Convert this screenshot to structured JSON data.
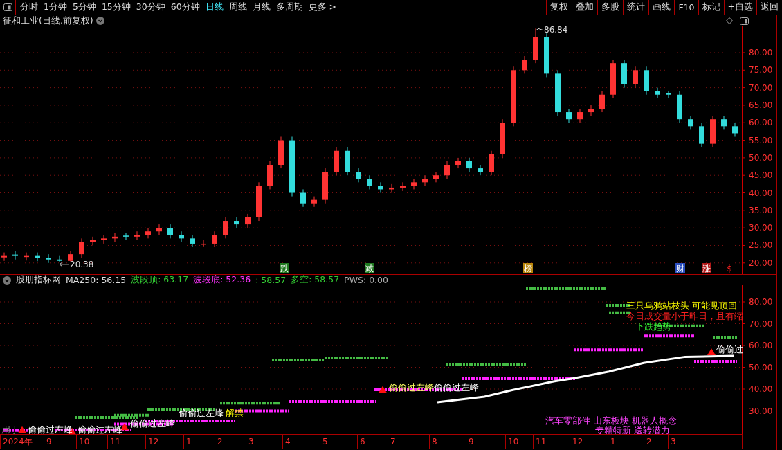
{
  "toolbar": {
    "periods": [
      {
        "label": "分时",
        "selected": false
      },
      {
        "label": "1分钟",
        "selected": false
      },
      {
        "label": "5分钟",
        "selected": false
      },
      {
        "label": "15分钟",
        "selected": false
      },
      {
        "label": "30分钟",
        "selected": false
      },
      {
        "label": "60分钟",
        "selected": false
      },
      {
        "label": "日线",
        "selected": true
      },
      {
        "label": "周线",
        "selected": false
      },
      {
        "label": "月线",
        "selected": false
      },
      {
        "label": "多周期",
        "selected": false
      },
      {
        "label": "更多 >",
        "selected": false
      }
    ],
    "buttons": [
      "复权",
      "叠加",
      "多股",
      "统计",
      "画线",
      "F10",
      "标记",
      "+自选",
      "返回"
    ]
  },
  "price_panel": {
    "title": "征和工业(日线.前复权)",
    "chart_data": {
      "type": "candlestick",
      "categories": [
        null,
        null,
        null,
        null,
        null,
        null,
        null,
        null,
        null,
        null,
        null,
        null,
        null,
        null,
        null,
        null,
        null,
        null,
        null,
        null,
        null,
        null,
        null,
        null,
        null,
        null,
        null,
        null,
        null,
        null,
        null,
        null,
        null,
        null,
        null,
        null,
        null,
        null,
        null,
        null,
        null,
        null,
        null,
        null,
        null,
        null,
        null,
        null,
        null,
        null,
        null,
        null,
        null,
        null,
        null,
        null,
        null,
        null,
        null,
        null,
        null,
        null,
        null,
        null,
        null,
        null,
        null
      ],
      "grid": true,
      "ylim": [
        16.8,
        87.5
      ],
      "yticks": [
        {
          "value": 20,
          "label": "20.00"
        },
        {
          "value": 25,
          "label": "25.00"
        },
        {
          "value": 30,
          "label": "30.00"
        },
        {
          "value": 35,
          "label": "35.00"
        },
        {
          "value": 40,
          "label": "40.00"
        },
        {
          "value": 45,
          "label": "45.00"
        },
        {
          "value": 50,
          "label": "50.00"
        },
        {
          "value": 55,
          "label": "55.00"
        },
        {
          "value": 60,
          "label": "60.00"
        },
        {
          "value": 65,
          "label": "65.00"
        },
        {
          "value": 70,
          "label": "70.00"
        },
        {
          "value": 75,
          "label": "75.00"
        },
        {
          "value": 80,
          "label": "80.00"
        }
      ],
      "ohlc": [
        [
          21.6,
          23,
          20.6,
          22
        ],
        [
          22.4,
          23.4,
          21,
          22
        ],
        [
          21.7,
          23,
          20.7,
          22
        ],
        [
          22,
          23,
          20.5,
          21.5
        ],
        [
          21.5,
          22.5,
          20,
          21
        ],
        [
          21,
          22,
          20.38,
          20.6
        ],
        [
          20.6,
          23.5,
          20.4,
          22.5
        ],
        [
          22.5,
          27,
          21.5,
          26
        ],
        [
          26,
          27.5,
          25,
          26.5
        ],
        [
          26.5,
          28,
          25.5,
          27
        ],
        [
          27,
          28.5,
          26,
          27.5
        ],
        [
          27.8,
          28.5,
          26.5,
          27.5
        ],
        [
          27.5,
          29,
          26.5,
          28
        ],
        [
          28,
          30,
          27,
          29
        ],
        [
          29,
          31,
          28,
          30
        ],
        [
          30,
          31,
          27,
          28
        ],
        [
          28,
          29,
          26,
          27
        ],
        [
          27,
          28,
          24.5,
          25.5
        ],
        [
          25.2,
          26.5,
          24.5,
          25.5
        ],
        [
          25.5,
          29,
          24.5,
          28
        ],
        [
          28,
          33,
          27,
          32
        ],
        [
          32,
          33,
          30,
          31
        ],
        [
          31,
          34,
          30,
          33
        ],
        [
          33,
          43,
          32,
          42
        ],
        [
          42,
          49,
          41,
          48
        ],
        [
          48,
          56,
          47,
          55
        ],
        [
          55,
          56,
          39,
          40
        ],
        [
          40,
          41,
          36,
          37
        ],
        [
          37,
          39,
          36,
          38
        ],
        [
          38,
          47,
          37,
          46
        ],
        [
          46,
          53,
          45,
          52
        ],
        [
          52,
          53,
          45,
          46
        ],
        [
          46,
          47,
          43,
          44
        ],
        [
          44,
          45,
          41,
          42
        ],
        [
          42,
          43,
          40,
          41
        ],
        [
          41,
          42.5,
          40,
          41.5
        ],
        [
          41.5,
          43,
          40.5,
          42
        ],
        [
          42,
          44,
          41,
          43
        ],
        [
          43,
          45,
          42,
          44
        ],
        [
          44,
          46,
          43,
          45
        ],
        [
          45,
          49,
          44,
          48
        ],
        [
          48,
          50,
          47,
          49
        ],
        [
          49,
          50,
          46,
          47
        ],
        [
          47,
          48,
          45,
          46
        ],
        [
          46,
          52,
          45,
          51
        ],
        [
          51,
          61,
          50,
          60
        ],
        [
          60,
          76,
          59,
          75
        ],
        [
          75,
          79,
          74,
          78
        ],
        [
          78,
          86.84,
          77,
          84.5
        ],
        [
          84.5,
          85.5,
          73,
          74
        ],
        [
          74,
          75,
          62,
          63
        ],
        [
          63,
          64,
          60,
          61
        ],
        [
          61,
          64,
          60,
          63
        ],
        [
          63,
          65,
          62,
          64
        ],
        [
          64,
          69,
          63,
          68
        ],
        [
          68,
          78,
          67,
          77
        ],
        [
          77,
          78,
          70,
          71
        ],
        [
          71,
          76,
          70,
          75
        ],
        [
          75,
          76,
          68,
          69
        ],
        [
          69,
          70,
          67,
          68
        ],
        [
          68.4,
          69,
          67,
          68
        ],
        [
          68,
          69,
          60,
          61
        ],
        [
          61,
          62,
          58,
          59
        ],
        [
          59,
          60,
          53,
          54
        ],
        [
          54,
          62,
          53,
          61
        ],
        [
          61,
          62,
          58,
          59
        ],
        [
          59,
          60,
          56,
          57
        ]
      ]
    },
    "price_labels": [
      "86.84",
      "20.38"
    ],
    "markers": [
      {
        "text": "跌",
        "kind": "badge",
        "color": "#1f7a1f"
      },
      {
        "text": "减",
        "kind": "badge",
        "color": "#1f7a1f"
      },
      {
        "text": "榜",
        "kind": "badge",
        "color": "#b8860b"
      },
      {
        "text": "财",
        "kind": "badge",
        "color": "#2a4fbf"
      },
      {
        "text": "涨",
        "kind": "badge",
        "color": "#b01818"
      },
      {
        "text": "$",
        "kind": "text"
      }
    ]
  },
  "indicator_panel": {
    "readouts": [
      {
        "text": "股朋指标网",
        "color": "#dddddd"
      },
      {
        "text": "MA250: 56.15",
        "color": "#dddddd"
      },
      {
        "text": "波段顶: 63.17",
        "color": "#33cc33"
      },
      {
        "text": "波段底: 52.36",
        "color": "#ff33ff"
      },
      {
        "text": ": 58.57",
        "color": "#33cc33"
      },
      {
        "text": "多空: 58.57",
        "color": "#33cc33"
      },
      {
        "text": "PWS: 0.00",
        "color": "#aaaaaa"
      }
    ],
    "axis_labels": [
      "80.00",
      "70.00",
      "60.00",
      "50.00",
      "40.00",
      "30.00"
    ],
    "notes": [
      {
        "text": "三只乌鸦站枝头 可能见顶回",
        "color": "#ffff00"
      },
      {
        "text": "今日成交量小于昨日，且有缩",
        "color": "#ff2020"
      },
      {
        "text": "下跌趋势",
        "color": "#33ee33"
      },
      {
        "text": "偷偷过",
        "color": "#ffffff"
      },
      {
        "text": "偷偷过左峰",
        "color": "#ffff66"
      },
      {
        "text": "偷偷过左峰",
        "color": "#ffffff"
      },
      {
        "text": "偷偷过左峰",
        "color": "#ffffff"
      },
      {
        "text": "解禁",
        "color": "#ffff00"
      },
      {
        "text": "偷偷过左峰",
        "color": "#ffffff"
      },
      {
        "text": "汽车零部件 山东板块 机器人概念",
        "color": "#ff44ff"
      },
      {
        "text": "用于",
        "color": "#888888"
      },
      {
        "text": "偷偷过左峰",
        "color": "#ffffff"
      },
      {
        "text": "偷偷过左峰",
        "color": "#ffffff"
      },
      {
        "text": "专精特新 送转潜力",
        "color": "#ff44ff"
      }
    ]
  },
  "date_axis": [
    "2024年",
    "9",
    "10",
    "11",
    "12",
    "1",
    "2",
    "3",
    "4",
    "5",
    "6",
    "7",
    "8",
    "9",
    "10",
    "11",
    "12",
    "1",
    "2",
    "3"
  ]
}
